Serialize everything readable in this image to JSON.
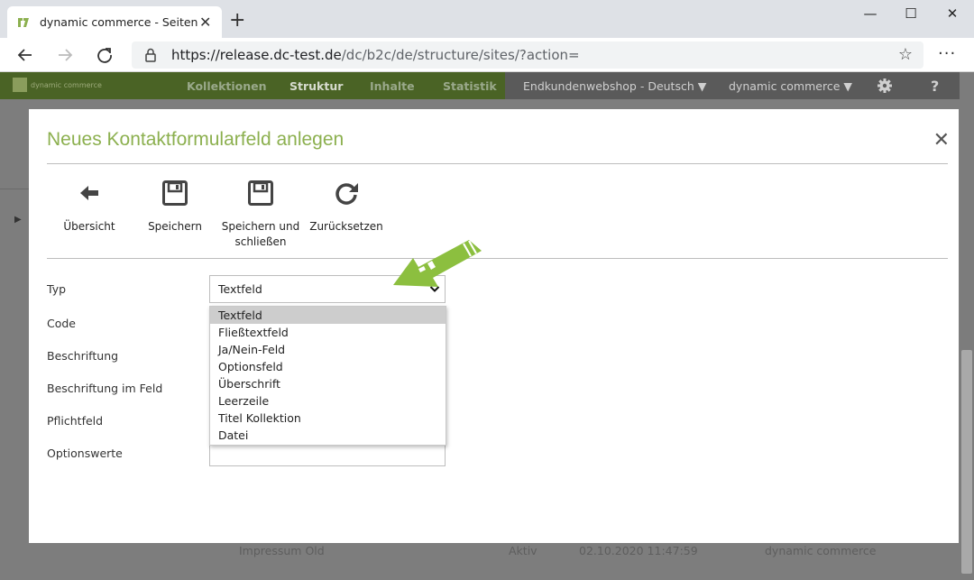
{
  "browser": {
    "tab_title": "dynamic commerce - Seiten",
    "url_host": "https://release.dc-test.de",
    "url_path": "/dc/b2c/de/structure/sites/?action=",
    "new_tab_symbol": "+",
    "minimize_symbol": "—",
    "maximize_symbol": "☐",
    "close_symbol": "✕",
    "more_symbol": "···"
  },
  "app_nav": {
    "logo_text": "dynamic commerce",
    "tabs": [
      "Kollektionen",
      "Struktur",
      "Inhalte",
      "Statistik"
    ],
    "active_tab": "Struktur",
    "shop_select": "Endkundenwebshop - Deutsch",
    "company_select": "dynamic commerce",
    "help_symbol": "?"
  },
  "background_row": {
    "name": "Impressum Old",
    "status": "Aktiv",
    "date": "02.10.2020 11:47:59",
    "owner": "dynamic commerce"
  },
  "modal": {
    "title": "Neues Kontaktformularfeld anlegen",
    "toolbar": {
      "overview": "Übersicht",
      "save": "Speichern",
      "save_close_1": "Speichern und",
      "save_close_2": "schließen",
      "reset": "Zurücksetzen"
    },
    "form": {
      "labels": {
        "typ": "Typ",
        "code": "Code",
        "beschriftung": "Beschriftung",
        "beschriftung_feld": "Beschriftung im Feld",
        "pflichtfeld": "Pflichtfeld",
        "optionswerte": "Optionswerte"
      },
      "typ_value": "Textfeld",
      "typ_options": [
        "Textfeld",
        "Fließtextfeld",
        "Ja/Nein-Feld",
        "Optionsfeld",
        "Überschrift",
        "Leerzeile",
        "Titel Kollektion",
        "Datei"
      ]
    }
  },
  "colors": {
    "accent_green": "#8cb04f",
    "nav_green_dimmed": "#4a6325",
    "annotation_arrow": "#8cbf3f"
  }
}
